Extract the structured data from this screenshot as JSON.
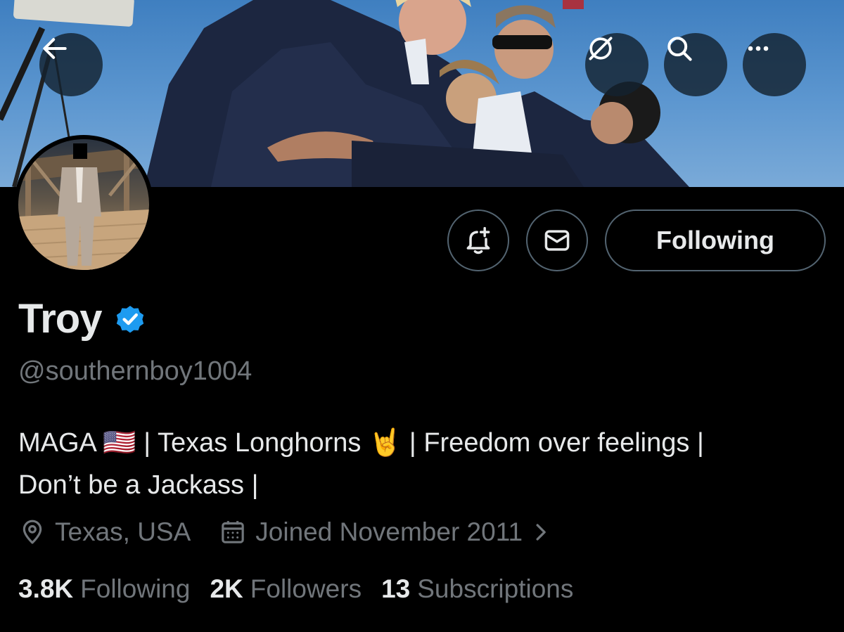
{
  "header": {
    "back_icon": "arrow-left-icon",
    "grok_icon": "grok-icon",
    "search_icon": "search-icon",
    "more_icon": "more-horizontal-icon"
  },
  "profile": {
    "display_name": "Troy",
    "verified": true,
    "handle": "@southernboy1004",
    "bio_line1_a": "MAGA",
    "bio_line1_b": "| Texas Longhorns",
    "bio_line1_c": "| Freedom over feelings |",
    "bio_line2": "Don’t be a Jackass |",
    "bio_emoji_flag": "🇺🇸",
    "bio_emoji_horns": "🤘",
    "location": "Texas, USA",
    "joined": "Joined November 2011",
    "joined_chevron": ">"
  },
  "actions": {
    "notify_icon": "bell-plus-icon",
    "message_icon": "mail-icon",
    "following_label": "Following"
  },
  "stats": [
    {
      "value": "3.8K",
      "label": "Following"
    },
    {
      "value": "2K",
      "label": "Followers"
    },
    {
      "value": "13",
      "label": "Subscriptions"
    }
  ],
  "colors": {
    "background": "#000000",
    "text_primary": "#e7e9ea",
    "text_secondary": "#71767b",
    "border": "#536471",
    "verified_blue": "#1d9bf0"
  }
}
